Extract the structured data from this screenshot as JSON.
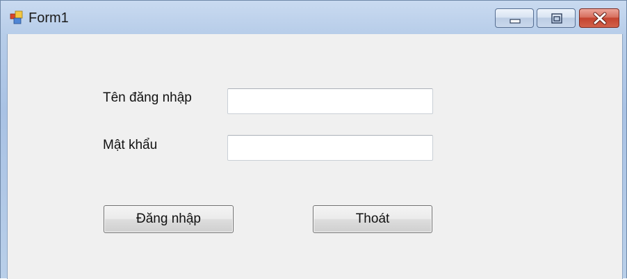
{
  "window": {
    "title": "Form1",
    "icon": "winforms-app-icon",
    "controls": {
      "minimize_icon": "minimize-icon",
      "maximize_icon": "maximize-icon",
      "close_icon": "close-icon"
    }
  },
  "form": {
    "username_label": "Tên đăng nhập",
    "username_value": "",
    "password_label": "Mật khẩu",
    "password_value": "",
    "login_button": "Đăng nhập",
    "exit_button": "Thoát"
  },
  "colors": {
    "client_background": "#f0f0f0",
    "titlebar": "#b7cde9",
    "close_button": "#c4432f"
  }
}
